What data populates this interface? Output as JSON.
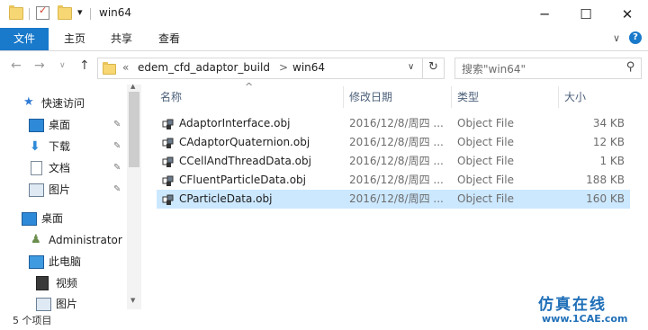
{
  "window": {
    "title": "win64",
    "minimize_glyph": "─",
    "maximize_glyph": "☐",
    "close_glyph": "✕",
    "qa_dropdown_glyph": "▾"
  },
  "ribbon": {
    "tabs": [
      "文件",
      "主页",
      "共享",
      "查看"
    ],
    "collapse_glyph": "∨",
    "help_glyph": "?"
  },
  "nav_buttons": {
    "back": "←",
    "forward": "→",
    "recent": "∨",
    "up": "↑"
  },
  "address": {
    "chevron": "«",
    "segments": [
      "edem_cfd_adaptor_build",
      "win64"
    ],
    "separator": ">",
    "dropdown": "∨",
    "refresh": "↻"
  },
  "search": {
    "placeholder": "搜索\"win64\"",
    "icon_glyph": "⚲"
  },
  "nav_pane": {
    "quick_access": "快速访问",
    "pinned": [
      {
        "label": "桌面",
        "icon": "desktop-icon"
      },
      {
        "label": "下载",
        "icon": "download-icon"
      },
      {
        "label": "文档",
        "icon": "document-icon"
      },
      {
        "label": "图片",
        "icon": "pictures-icon"
      }
    ],
    "pin_glyph": "📌",
    "desktop": "桌面",
    "user": "Administrator",
    "this_pc": "此电脑",
    "pc_children": [
      {
        "label": "视频",
        "icon": "video-icon"
      },
      {
        "label": "图片",
        "icon": "pictures-icon"
      }
    ],
    "scroll_up": "▲",
    "scroll_down": "▼"
  },
  "columns": {
    "name": "名称",
    "date": "修改日期",
    "type": "类型",
    "size": "大小",
    "sort_glyph": "^"
  },
  "files": [
    {
      "name": "AdaptorInterface.obj",
      "date": "2016/12/8/周四 ...",
      "type": "Object File",
      "size": "34 KB"
    },
    {
      "name": "CAdaptorQuaternion.obj",
      "date": "2016/12/8/周四 ...",
      "type": "Object File",
      "size": "12 KB"
    },
    {
      "name": "CCellAndThreadData.obj",
      "date": "2016/12/8/周四 ...",
      "type": "Object File",
      "size": "1 KB"
    },
    {
      "name": "CFluentParticleData.obj",
      "date": "2016/12/8/周四 ...",
      "type": "Object File",
      "size": "188 KB"
    },
    {
      "name": "CParticleData.obj",
      "date": "2016/12/8/周四 ...",
      "type": "Object File",
      "size": "160 KB"
    }
  ],
  "status": {
    "count": "5 个项目"
  },
  "watermark": {
    "brand": "仿真在线",
    "url": "www.1CAE.com"
  },
  "colors": {
    "accent": "#1979ca",
    "selection": "#cce8ff",
    "folder": "#f7d774"
  }
}
